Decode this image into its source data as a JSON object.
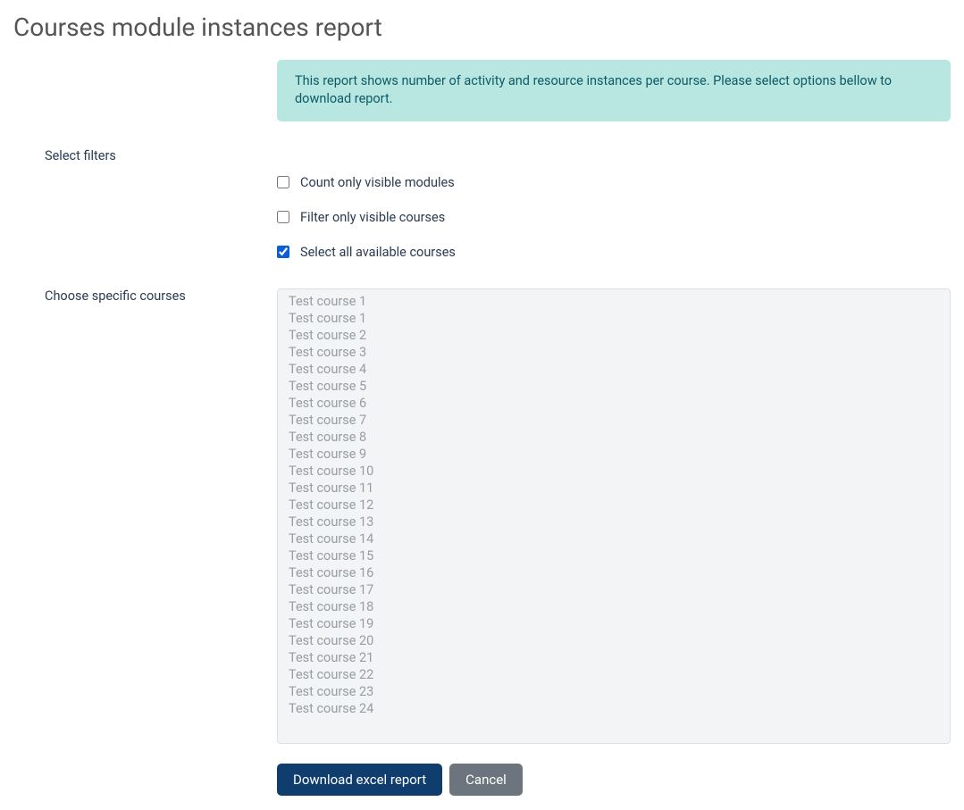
{
  "title": "Courses module instances report",
  "info_text": "This report shows number of activity and resource instances per course. Please select options bellow to download report.",
  "filters": {
    "section_label": "Select filters",
    "count_visible_modules": {
      "label": "Count only visible modules",
      "checked": false
    },
    "filter_visible_courses": {
      "label": "Filter only visible courses",
      "checked": false
    },
    "select_all_courses": {
      "label": "Select all available courses",
      "checked": true
    }
  },
  "course_select": {
    "label": "Choose specific courses",
    "disabled": true,
    "options": [
      "Test course 1",
      "Test course 1",
      "Test course 2",
      "Test course 3",
      "Test course 4",
      "Test course 5",
      "Test course 6",
      "Test course 7",
      "Test course 8",
      "Test course 9",
      "Test course 10",
      "Test course 11",
      "Test course 12",
      "Test course 13",
      "Test course 14",
      "Test course 15",
      "Test course 16",
      "Test course 17",
      "Test course 18",
      "Test course 19",
      "Test course 20",
      "Test course 21",
      "Test course 22",
      "Test course 23",
      "Test course 24"
    ]
  },
  "buttons": {
    "download": "Download excel report",
    "cancel": "Cancel"
  }
}
